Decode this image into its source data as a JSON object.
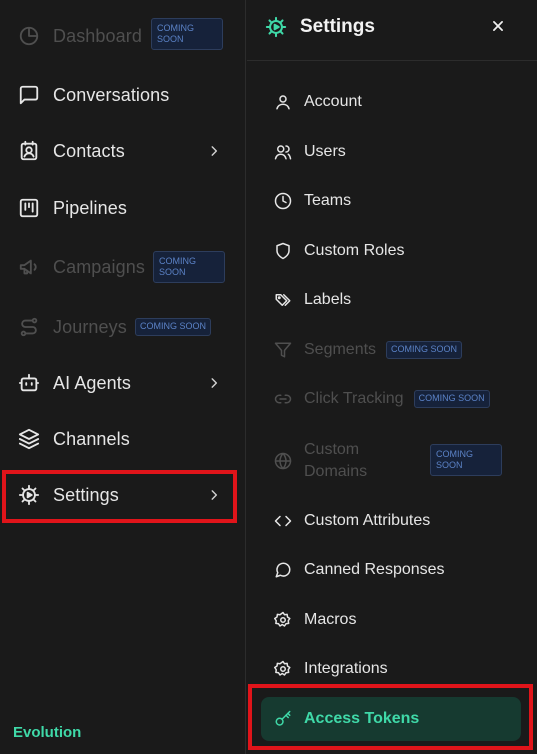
{
  "sidebar": {
    "items": [
      {
        "label": "Dashboard",
        "badge": "COMING SOON",
        "disabled": true
      },
      {
        "label": "Conversations"
      },
      {
        "label": "Contacts"
      },
      {
        "label": "Pipelines"
      },
      {
        "label": "Campaigns",
        "badge": "COMING SOON",
        "disabled": true
      },
      {
        "label": "Journeys",
        "badge": "COMING SOON",
        "disabled": true
      },
      {
        "label": "AI Agents"
      },
      {
        "label": "Channels"
      },
      {
        "label": "Settings"
      }
    ],
    "footer_brand": "Evolution"
  },
  "settings_panel": {
    "title": "Settings",
    "items": [
      {
        "label": "Account"
      },
      {
        "label": "Users"
      },
      {
        "label": "Teams"
      },
      {
        "label": "Custom Roles"
      },
      {
        "label": "Labels"
      },
      {
        "label": "Segments",
        "badge": "COMING SOON",
        "disabled": true
      },
      {
        "label": "Click Tracking",
        "badge": "COMING SOON",
        "disabled": true
      },
      {
        "label": "Custom\nDomains",
        "badge": "COMING SOON",
        "disabled": true
      },
      {
        "label": "Custom Attributes"
      },
      {
        "label": "Canned Responses"
      },
      {
        "label": "Macros"
      },
      {
        "label": "Integrations"
      },
      {
        "label": "Access Tokens",
        "active": true
      }
    ]
  },
  "colors": {
    "background": "#1a1a1a",
    "accent": "#3fd9a8",
    "active_bg": "#163a30",
    "highlight": "#e0141a",
    "badge_text": "#5b82c6"
  }
}
